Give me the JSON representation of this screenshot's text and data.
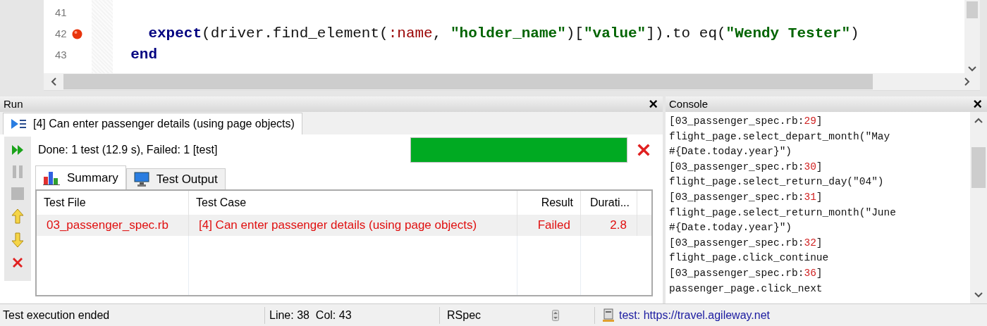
{
  "editor": {
    "lines": [
      {
        "number": "41",
        "breakpoint": false
      },
      {
        "number": "42",
        "breakpoint": true,
        "tokens": [
          {
            "kind": "keyword",
            "text": "    expect"
          },
          {
            "kind": "plain",
            "text": "(driver.find_element("
          },
          {
            "kind": "symbol",
            "text": ":name"
          },
          {
            "kind": "plain",
            "text": ", "
          },
          {
            "kind": "string",
            "text": "\"holder_name\""
          },
          {
            "kind": "plain",
            "text": ")["
          },
          {
            "kind": "string",
            "text": "\"value\""
          },
          {
            "kind": "plain",
            "text": "]).to eq("
          },
          {
            "kind": "string",
            "text": "\"Wendy Tester\""
          },
          {
            "kind": "plain",
            "text": ")"
          }
        ]
      },
      {
        "number": "43",
        "breakpoint": false,
        "tokens": [
          {
            "kind": "keyword",
            "text": "  end"
          }
        ]
      }
    ]
  },
  "run_panel": {
    "title": "Run",
    "close": "×",
    "test_tab": "[4] Can enter passenger details (using page objects)",
    "tools": [
      {
        "kind": "run",
        "disabled": false
      },
      {
        "kind": "pause",
        "disabled": true
      },
      {
        "kind": "stop",
        "disabled": true
      },
      {
        "kind": "up",
        "disabled": false
      },
      {
        "kind": "down",
        "disabled": false
      },
      {
        "kind": "clear",
        "disabled": false
      }
    ],
    "summary": "Done: 1 test (12.9 s), Failed: 1 [test]",
    "progress": {
      "level": 1,
      "color": "#00aa22"
    },
    "failed": true,
    "tabs": [
      {
        "label": "Summary",
        "kind": "chart",
        "selected": true
      },
      {
        "label": "Test Output",
        "kind": "monitor",
        "selected": false
      }
    ],
    "table": {
      "columns": [
        "Test File",
        "Test Case",
        "Result",
        "Durati..."
      ],
      "rows": [
        {
          "failed": true,
          "cells": [
            "03_passenger_spec.rb",
            "[4] Can enter passenger details (using page objects)",
            "Failed",
            "2.8"
          ]
        }
      ]
    }
  },
  "console": {
    "title": "Console",
    "close": "×",
    "lines": [
      {
        "kind": "ref",
        "text": "[03_passenger_spec.rb:",
        "line": "29",
        "end": "]"
      },
      {
        "kind": "code",
        "text": "flight_page.select_depart_month(\"May"
      },
      {
        "kind": "code",
        "text": "#{Date.today.year}\")"
      },
      {
        "kind": "ref",
        "text": "[03_passenger_spec.rb:",
        "line": "30",
        "end": "]"
      },
      {
        "kind": "code",
        "text": "flight_page.select_return_day(\"04\")"
      },
      {
        "kind": "ref",
        "text": "[03_passenger_spec.rb:",
        "line": "31",
        "end": "]"
      },
      {
        "kind": "code",
        "text": "flight_page.select_return_month(\"June"
      },
      {
        "kind": "code",
        "text": "#{Date.today.year}\")"
      },
      {
        "kind": "ref",
        "text": "[03_passenger_spec.rb:",
        "line": "32",
        "end": "]"
      },
      {
        "kind": "code",
        "text": "flight_page.click_continue"
      },
      {
        "kind": "ref",
        "text": "[03_passenger_spec.rb:",
        "line": "36",
        "end": "]"
      },
      {
        "kind": "code",
        "text": "passenger_page.click_next"
      }
    ]
  },
  "status_bar": {
    "message": "Test execution ended",
    "position": "Line: 38  Col: 43",
    "framework": "RSpec",
    "server_label": "test:",
    "server_url": "https://travel.agileway.net"
  }
}
